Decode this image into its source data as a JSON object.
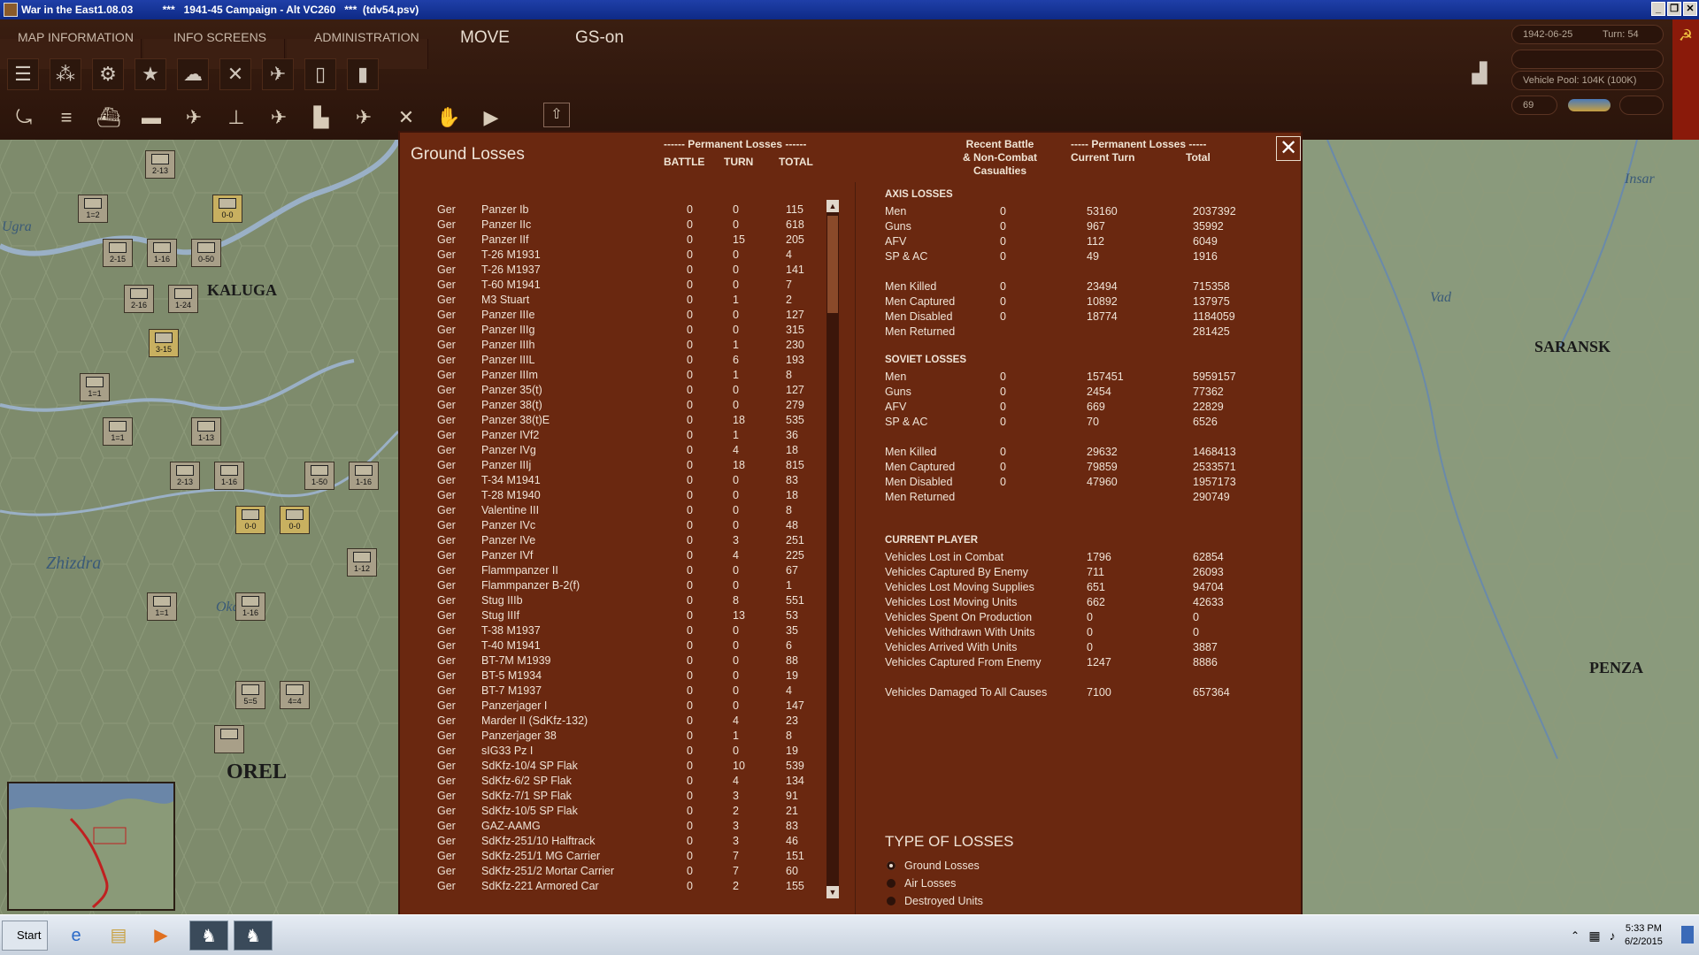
{
  "window": {
    "title": "War in the East1.08.03          ***   1941-45 Campaign - Alt VC260   ***  (tdv54.psv)"
  },
  "menubar": {
    "items": [
      "MAP INFORMATION",
      "INFO SCREENS",
      "ADMINISTRATION"
    ],
    "mode": "MOVE",
    "gs": "GS-on"
  },
  "status": {
    "date": "1942-06-25",
    "turn": "Turn: 54",
    "vehicle_pool": "Vehicle Pool: 104K (100K)",
    "counter": "69"
  },
  "map": {
    "towns": [
      "KALUGA",
      "OREL",
      "SARANSK",
      "PENZA"
    ],
    "rivers": [
      "Zhizdra",
      "Oka",
      "Ugra",
      "Insar",
      "Vad"
    ]
  },
  "dialog": {
    "title": "Ground Losses",
    "perm_header": "------ Permanent Losses ------",
    "col_battle": "BATTLE",
    "col_turn": "TURN",
    "col_total": "TOTAL",
    "recent_header": "Recent Battle\n& Non-Combat\nCasualties",
    "perm_header2": "----- Permanent Losses -----",
    "col_current": "Current Turn",
    "col_total2": "Total",
    "close_label": "✕",
    "equipment": [
      [
        "Ger",
        "Panzer Ib",
        "0",
        "0",
        "115"
      ],
      [
        "Ger",
        "Panzer IIc",
        "0",
        "0",
        "618"
      ],
      [
        "Ger",
        "Panzer IIf",
        "0",
        "15",
        "205"
      ],
      [
        "Ger",
        "T-26 M1931",
        "0",
        "0",
        "4"
      ],
      [
        "Ger",
        "T-26 M1937",
        "0",
        "0",
        "141"
      ],
      [
        "Ger",
        "T-60 M1941",
        "0",
        "0",
        "7"
      ],
      [
        "Ger",
        "M3 Stuart",
        "0",
        "1",
        "2"
      ],
      [
        "Ger",
        "Panzer IIIe",
        "0",
        "0",
        "127"
      ],
      [
        "Ger",
        "Panzer IIIg",
        "0",
        "0",
        "315"
      ],
      [
        "Ger",
        "Panzer IIIh",
        "0",
        "1",
        "230"
      ],
      [
        "Ger",
        "Panzer IIIL",
        "0",
        "6",
        "193"
      ],
      [
        "Ger",
        "Panzer IIIm",
        "0",
        "1",
        "8"
      ],
      [
        "Ger",
        "Panzer 35(t)",
        "0",
        "0",
        "127"
      ],
      [
        "Ger",
        "Panzer 38(t)",
        "0",
        "0",
        "279"
      ],
      [
        "Ger",
        "Panzer 38(t)E",
        "0",
        "18",
        "535"
      ],
      [
        "Ger",
        "Panzer IVf2",
        "0",
        "1",
        "36"
      ],
      [
        "Ger",
        "Panzer IVg",
        "0",
        "4",
        "18"
      ],
      [
        "Ger",
        "Panzer IIIj",
        "0",
        "18",
        "815"
      ],
      [
        "Ger",
        "T-34 M1941",
        "0",
        "0",
        "83"
      ],
      [
        "Ger",
        "T-28 M1940",
        "0",
        "0",
        "18"
      ],
      [
        "Ger",
        "Valentine III",
        "0",
        "0",
        "8"
      ],
      [
        "Ger",
        "Panzer IVc",
        "0",
        "0",
        "48"
      ],
      [
        "Ger",
        "Panzer IVe",
        "0",
        "3",
        "251"
      ],
      [
        "Ger",
        "Panzer IVf",
        "0",
        "4",
        "225"
      ],
      [
        "Ger",
        "Flammpanzer II",
        "0",
        "0",
        "67"
      ],
      [
        "Ger",
        "Flammpanzer B-2(f)",
        "0",
        "0",
        "1"
      ],
      [
        "Ger",
        "Stug IIIb",
        "0",
        "8",
        "551"
      ],
      [
        "Ger",
        "Stug IIIf",
        "0",
        "13",
        "53"
      ],
      [
        "Ger",
        "T-38 M1937",
        "0",
        "0",
        "35"
      ],
      [
        "Ger",
        "T-40 M1941",
        "0",
        "0",
        "6"
      ],
      [
        "Ger",
        "BT-7M M1939",
        "0",
        "0",
        "88"
      ],
      [
        "Ger",
        "BT-5 M1934",
        "0",
        "0",
        "19"
      ],
      [
        "Ger",
        "BT-7 M1937",
        "0",
        "0",
        "4"
      ],
      [
        "Ger",
        "Panzerjager I",
        "0",
        "0",
        "147"
      ],
      [
        "Ger",
        "Marder II (SdKfz-132)",
        "0",
        "4",
        "23"
      ],
      [
        "Ger",
        "Panzerjager 38",
        "0",
        "1",
        "8"
      ],
      [
        "Ger",
        "sIG33 Pz I",
        "0",
        "0",
        "19"
      ],
      [
        "Ger",
        "SdKfz-10/4 SP Flak",
        "0",
        "10",
        "539"
      ],
      [
        "Ger",
        "SdKfz-6/2 SP Flak",
        "0",
        "4",
        "134"
      ],
      [
        "Ger",
        "SdKfz-7/1 SP Flak",
        "0",
        "3",
        "91"
      ],
      [
        "Ger",
        "SdKfz-10/5 SP Flak",
        "0",
        "2",
        "21"
      ],
      [
        "Ger",
        "GAZ-AAMG",
        "0",
        "3",
        "83"
      ],
      [
        "Ger",
        "SdKfz-251/10 Halftrack",
        "0",
        "3",
        "46"
      ],
      [
        "Ger",
        "SdKfz-251/1 MG Carrier",
        "0",
        "7",
        "151"
      ],
      [
        "Ger",
        "SdKfz-251/2 Mortar Carrier",
        "0",
        "7",
        "60"
      ],
      [
        "Ger",
        "SdKfz-221 Armored Car",
        "0",
        "2",
        "155"
      ]
    ],
    "axis_title": "AXIS LOSSES",
    "axis": [
      [
        "Men",
        "0",
        "53160",
        "2037392"
      ],
      [
        "Guns",
        "0",
        "967",
        "35992"
      ],
      [
        "AFV",
        "0",
        "112",
        "6049"
      ],
      [
        "SP & AC",
        "0",
        "49",
        "1916"
      ],
      [
        "",
        "",
        "",
        ""
      ],
      [
        "Men Killed",
        "0",
        "23494",
        "715358"
      ],
      [
        "Men Captured",
        "0",
        "10892",
        "137975"
      ],
      [
        "Men Disabled",
        "0",
        "18774",
        "1184059"
      ],
      [
        "Men Returned",
        "",
        "",
        "281425"
      ]
    ],
    "soviet_title": "SOVIET LOSSES",
    "soviet": [
      [
        "Men",
        "0",
        "157451",
        "5959157"
      ],
      [
        "Guns",
        "0",
        "2454",
        "77362"
      ],
      [
        "AFV",
        "0",
        "669",
        "22829"
      ],
      [
        "SP & AC",
        "0",
        "70",
        "6526"
      ],
      [
        "",
        "",
        "",
        ""
      ],
      [
        "Men Killed",
        "0",
        "29632",
        "1468413"
      ],
      [
        "Men Captured",
        "0",
        "79859",
        "2533571"
      ],
      [
        "Men Disabled",
        "0",
        "47960",
        "1957173"
      ],
      [
        "Men Returned",
        "",
        "",
        "290749"
      ]
    ],
    "player_title": "CURRENT PLAYER",
    "player": [
      [
        "Vehicles Lost in Combat",
        "1796",
        "62854"
      ],
      [
        "Vehicles Captured By Enemy",
        "711",
        "26093"
      ],
      [
        "Vehicles Lost Moving Supplies",
        "651",
        "94704"
      ],
      [
        "Vehicles Lost Moving Units",
        "662",
        "42633"
      ],
      [
        "Vehicles Spent On Production",
        "0",
        "0"
      ],
      [
        "Vehicles Withdrawn With Units",
        "0",
        "0"
      ],
      [
        "Vehicles Arrived With Units",
        "0",
        "3887"
      ],
      [
        "Vehicles Captured From Enemy",
        "1247",
        "8886"
      ],
      [
        "",
        "",
        ""
      ],
      [
        "Vehicles Damaged To All Causes",
        "7100",
        "657364"
      ]
    ],
    "type_title": "TYPE OF LOSSES",
    "types": [
      "Ground Losses",
      "Air Losses",
      "Destroyed Units"
    ],
    "selected_type": "Ground Losses"
  },
  "taskbar": {
    "start": "Start",
    "time": "5:33 PM",
    "date": "6/2/2015"
  }
}
